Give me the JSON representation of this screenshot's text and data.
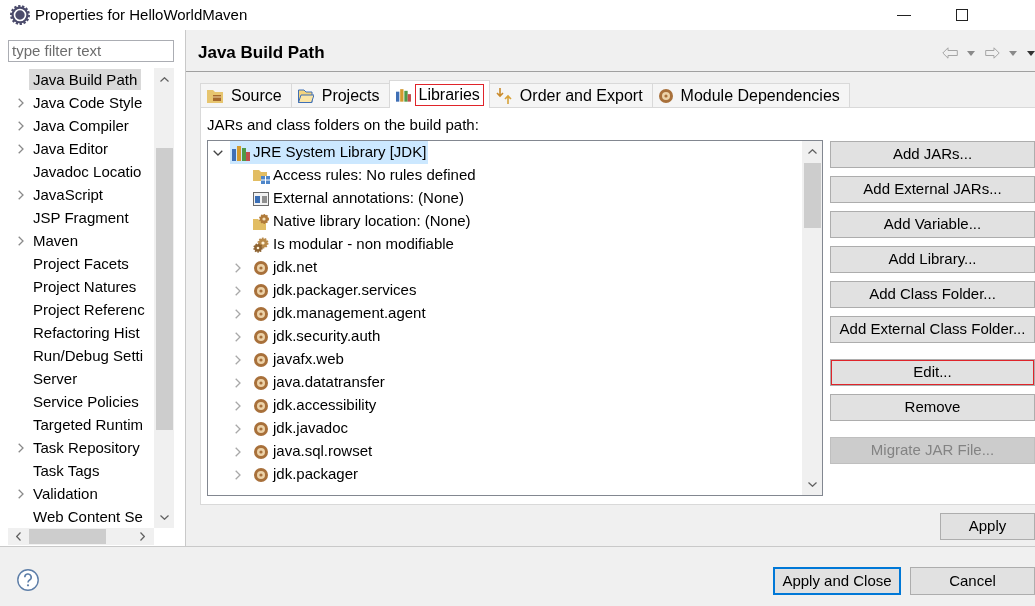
{
  "window": {
    "title": "Properties for HelloWorldMaven"
  },
  "sidebar": {
    "filter": {
      "placeholder": "type filter text"
    },
    "items": [
      {
        "label": "Java Build Path",
        "selected": true,
        "expandable": false
      },
      {
        "label": "Java Code Style",
        "selected": false,
        "expandable": true
      },
      {
        "label": "Java Compiler",
        "selected": false,
        "expandable": true
      },
      {
        "label": "Java Editor",
        "selected": false,
        "expandable": true
      },
      {
        "label": "Javadoc Locatio",
        "selected": false,
        "expandable": false
      },
      {
        "label": "JavaScript",
        "selected": false,
        "expandable": true
      },
      {
        "label": "JSP Fragment",
        "selected": false,
        "expandable": false
      },
      {
        "label": "Maven",
        "selected": false,
        "expandable": true
      },
      {
        "label": "Project Facets",
        "selected": false,
        "expandable": false
      },
      {
        "label": "Project Natures",
        "selected": false,
        "expandable": false
      },
      {
        "label": "Project Referenc",
        "selected": false,
        "expandable": false
      },
      {
        "label": "Refactoring Hist",
        "selected": false,
        "expandable": false
      },
      {
        "label": "Run/Debug Setti",
        "selected": false,
        "expandable": false
      },
      {
        "label": "Server",
        "selected": false,
        "expandable": false
      },
      {
        "label": "Service Policies",
        "selected": false,
        "expandable": false
      },
      {
        "label": "Targeted Runtim",
        "selected": false,
        "expandable": false
      },
      {
        "label": "Task Repository",
        "selected": false,
        "expandable": true
      },
      {
        "label": "Task Tags",
        "selected": false,
        "expandable": false
      },
      {
        "label": "Validation",
        "selected": false,
        "expandable": true
      },
      {
        "label": "Web Content Se",
        "selected": false,
        "expandable": false
      }
    ]
  },
  "page": {
    "title": "Java Build Path"
  },
  "tabs": [
    {
      "label": "Source",
      "kind": "source",
      "selected": false,
      "highlighted": false
    },
    {
      "label": "Projects",
      "kind": "projects",
      "selected": false,
      "highlighted": false
    },
    {
      "label": "Libraries",
      "kind": "libraries",
      "selected": true,
      "highlighted": true
    },
    {
      "label": "Order and Export",
      "kind": "order",
      "selected": false,
      "highlighted": false
    },
    {
      "label": "Module Dependencies",
      "kind": "modules",
      "selected": false,
      "highlighted": false
    }
  ],
  "libraries": {
    "caption": "JARs and class folders on the build path:",
    "tree": [
      {
        "label": "JRE System Library [JDK]",
        "kind": "library",
        "expanded": true,
        "selected": true,
        "children": [
          {
            "label": "Access rules: No rules defined",
            "kind": "access",
            "selected": false
          },
          {
            "label": "External annotations: (None)",
            "kind": "annotations",
            "selected": false
          },
          {
            "label": "Native library location: (None)",
            "kind": "native",
            "selected": false
          },
          {
            "label": "Is modular - non modifiable",
            "kind": "modular",
            "selected": false
          },
          {
            "label": "jdk.net",
            "kind": "module",
            "expanded": false,
            "selected": false
          },
          {
            "label": "jdk.packager.services",
            "kind": "module",
            "expanded": false,
            "selected": false
          },
          {
            "label": "jdk.management.agent",
            "kind": "module",
            "expanded": false,
            "selected": false
          },
          {
            "label": "jdk.security.auth",
            "kind": "module",
            "expanded": false,
            "selected": false
          },
          {
            "label": "javafx.web",
            "kind": "module",
            "expanded": false,
            "selected": false
          },
          {
            "label": "java.datatransfer",
            "kind": "module",
            "expanded": false,
            "selected": false
          },
          {
            "label": "jdk.accessibility",
            "kind": "module",
            "expanded": false,
            "selected": false
          },
          {
            "label": "jdk.javadoc",
            "kind": "module",
            "expanded": false,
            "selected": false
          },
          {
            "label": "java.sql.rowset",
            "kind": "module",
            "expanded": false,
            "selected": false
          },
          {
            "label": "jdk.packager",
            "kind": "module",
            "expanded": false,
            "selected": false
          }
        ]
      }
    ],
    "button_groups": [
      [
        {
          "label": "Add JARs...",
          "disabled": false,
          "highlighted": false
        },
        {
          "label": "Add External JARs...",
          "disabled": false,
          "highlighted": false
        },
        {
          "label": "Add Variable...",
          "disabled": false,
          "highlighted": false
        },
        {
          "label": "Add Library...",
          "disabled": false,
          "highlighted": false
        },
        {
          "label": "Add Class Folder...",
          "disabled": false,
          "highlighted": false
        },
        {
          "label": "Add External Class Folder...",
          "disabled": false,
          "highlighted": false
        }
      ],
      [
        {
          "label": "Edit...",
          "disabled": false,
          "highlighted": true
        },
        {
          "label": "Remove",
          "disabled": false,
          "highlighted": false
        }
      ],
      [
        {
          "label": "Migrate JAR File...",
          "disabled": true,
          "highlighted": false
        }
      ]
    ]
  },
  "apply_button": {
    "label": "Apply"
  },
  "footer": {
    "buttons": [
      {
        "label": "Apply and Close",
        "default": true
      },
      {
        "label": "Cancel",
        "default": false
      }
    ]
  }
}
